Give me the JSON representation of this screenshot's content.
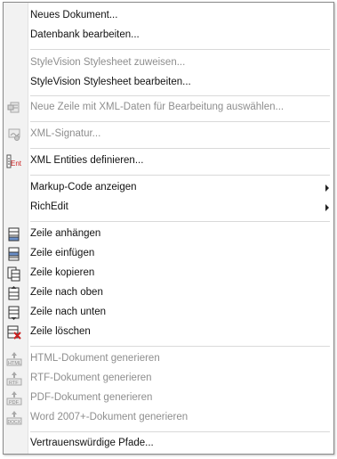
{
  "menu": {
    "items": [
      {
        "label": "Neues Dokument...",
        "enabled": true,
        "submenu": false,
        "icon": ""
      },
      {
        "label": "Datenbank bearbeiten...",
        "enabled": true,
        "submenu": false,
        "icon": ""
      },
      {
        "label": "StyleVision Stylesheet zuweisen...",
        "enabled": false,
        "submenu": false,
        "icon": ""
      },
      {
        "label": "StyleVision Stylesheet bearbeiten...",
        "enabled": true,
        "submenu": false,
        "icon": ""
      },
      {
        "label": "Neue Zeile mit XML-Daten für Bearbeitung auswählen...",
        "enabled": false,
        "submenu": false,
        "icon": "xml-row-select-icon"
      },
      {
        "label": "XML-Signatur...",
        "enabled": false,
        "submenu": false,
        "icon": "xml-signature-icon"
      },
      {
        "label": "XML Entities definieren...",
        "enabled": true,
        "submenu": false,
        "icon": "xml-entities-icon"
      },
      {
        "label": "Markup-Code anzeigen",
        "enabled": true,
        "submenu": true,
        "icon": ""
      },
      {
        "label": "RichEdit",
        "enabled": true,
        "submenu": true,
        "icon": ""
      },
      {
        "label": "Zeile anhängen",
        "enabled": true,
        "submenu": false,
        "icon": "append-row-icon"
      },
      {
        "label": "Zeile einfügen",
        "enabled": true,
        "submenu": false,
        "icon": "insert-row-icon"
      },
      {
        "label": "Zeile kopieren",
        "enabled": true,
        "submenu": false,
        "icon": "copy-row-icon"
      },
      {
        "label": "Zeile nach oben",
        "enabled": true,
        "submenu": false,
        "icon": "move-row-up-icon"
      },
      {
        "label": "Zeile nach unten",
        "enabled": true,
        "submenu": false,
        "icon": "move-row-down-icon"
      },
      {
        "label": "Zeile löschen",
        "enabled": true,
        "submenu": false,
        "icon": "delete-row-icon"
      },
      {
        "label": "HTML-Dokument generieren",
        "enabled": false,
        "submenu": false,
        "icon": "html-generate-icon"
      },
      {
        "label": "RTF-Dokument generieren",
        "enabled": false,
        "submenu": false,
        "icon": "rtf-generate-icon"
      },
      {
        "label": "PDF-Dokument generieren",
        "enabled": false,
        "submenu": false,
        "icon": "pdf-generate-icon"
      },
      {
        "label": "Word 2007+-Dokument generieren",
        "enabled": false,
        "submenu": false,
        "icon": "word-generate-icon"
      },
      {
        "label": "Vertrauenswürdige Pfade...",
        "enabled": true,
        "submenu": false,
        "icon": ""
      }
    ],
    "icon_texts": {
      "entities": "Ent",
      "html": "HTML",
      "rtf": "RTF",
      "pdf": "PDF",
      "word": "DOCX"
    }
  },
  "colors": {
    "disabled_text": "#8e8e8e",
    "accent_red": "#cc2222"
  }
}
